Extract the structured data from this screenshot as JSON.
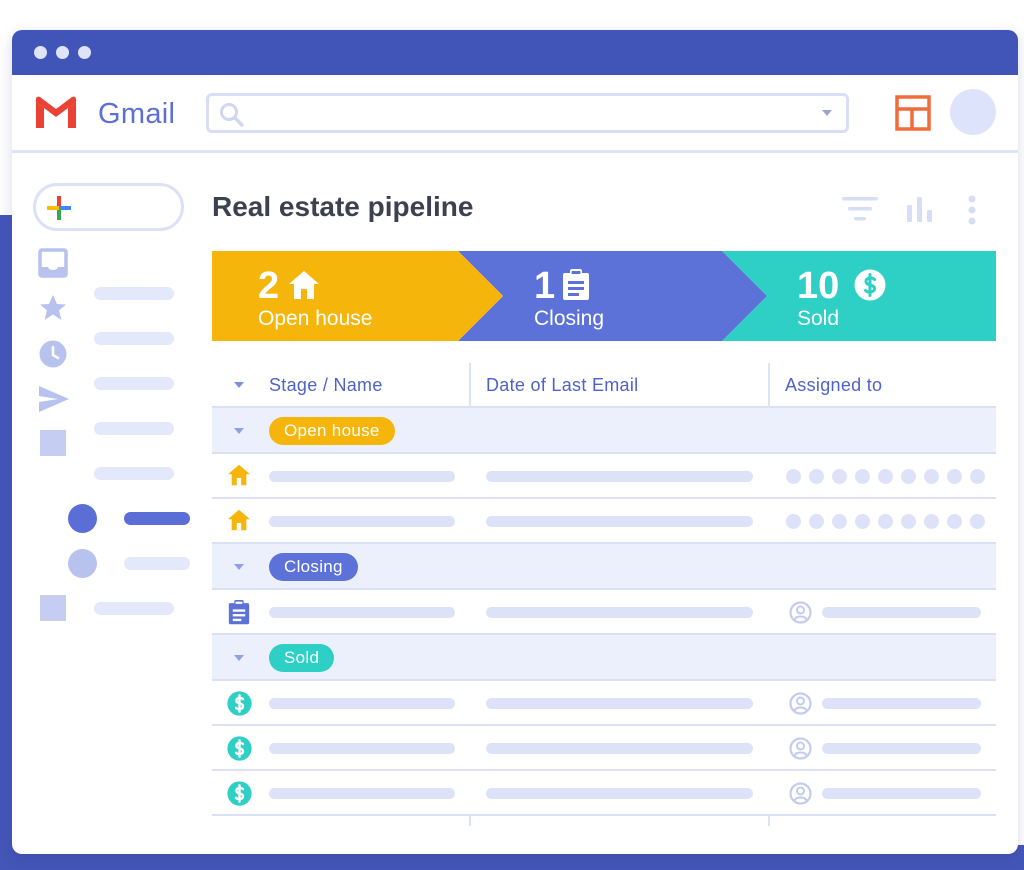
{
  "app": {
    "name": "Gmail",
    "colors": {
      "titlebar": "#4154b8",
      "accent": "#5b6fd6",
      "open_house": "#f5b50a",
      "closing": "#5c72d8",
      "sold": "#2ecfc4"
    }
  },
  "search": {
    "placeholder": "",
    "value": ""
  },
  "sidebar": {
    "compose_icon": "plus-icon",
    "items": [
      {
        "icon": "inbox-icon"
      },
      {
        "icon": "star-icon"
      },
      {
        "icon": "clock-icon"
      },
      {
        "icon": "send-icon"
      },
      {
        "icon": "label-square-icon"
      },
      {
        "icon": "label-circle-icon",
        "active": true
      },
      {
        "icon": "label-circle-icon"
      },
      {
        "icon": "label-square-icon"
      }
    ]
  },
  "main": {
    "title": "Real estate pipeline",
    "tools": [
      "filter-icon",
      "bar-chart-icon",
      "more-vert-icon"
    ]
  },
  "pipeline": {
    "stages": [
      {
        "count": "2",
        "label": "Open house",
        "icon": "house-icon"
      },
      {
        "count": "1",
        "label": "Closing",
        "icon": "clipboard-icon"
      },
      {
        "count": "10",
        "label": "Sold",
        "icon": "dollar-icon"
      }
    ]
  },
  "table": {
    "columns": [
      "Stage / Name",
      "Date of Last Email",
      "Assigned to"
    ],
    "groups": [
      {
        "stage": "Open house",
        "rows": 2,
        "row_icon": "house-icon",
        "assignee": "dots"
      },
      {
        "stage": "Closing",
        "rows": 1,
        "row_icon": "clipboard-icon",
        "assignee": "person"
      },
      {
        "stage": "Sold",
        "rows": 3,
        "row_icon": "dollar-icon",
        "assignee": "person"
      }
    ]
  }
}
